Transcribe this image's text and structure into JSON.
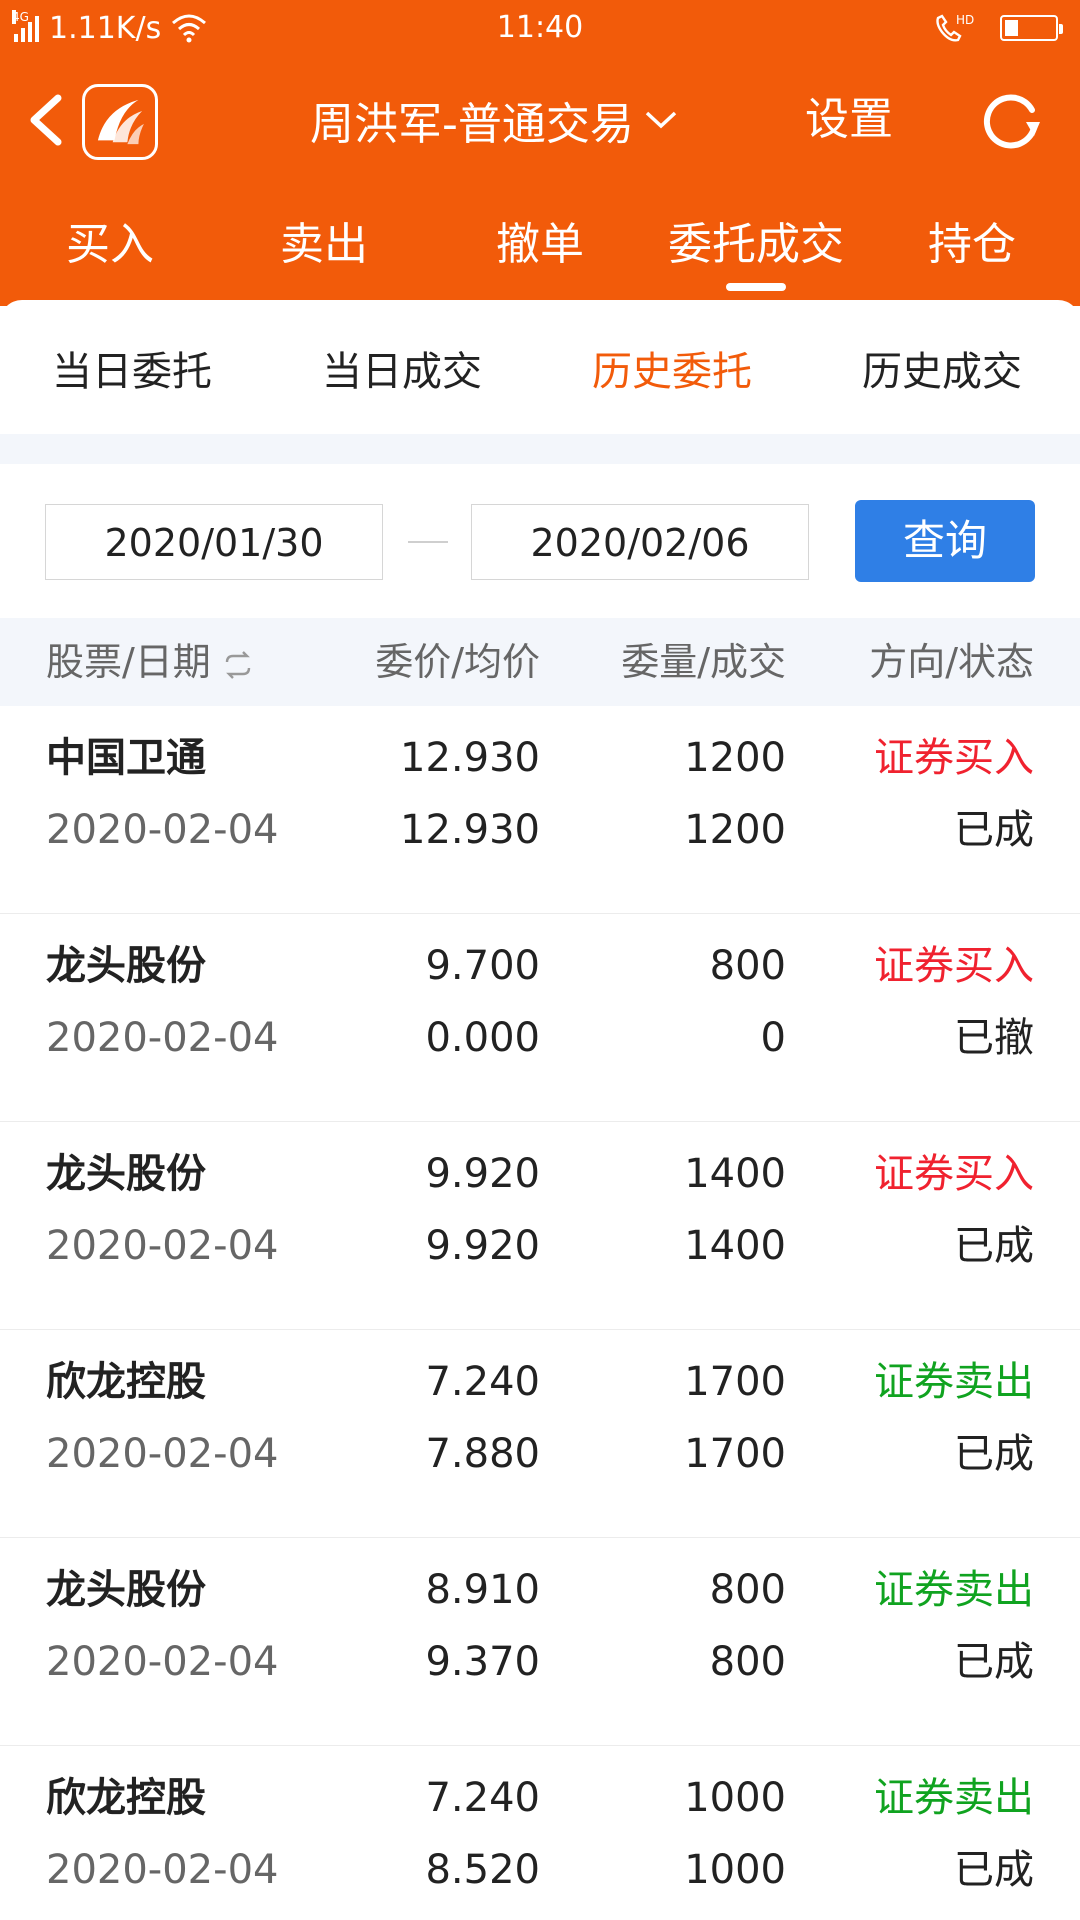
{
  "status_bar": {
    "network": "4G",
    "speed": "1.11K/s",
    "time": "11:40",
    "hd": "HD",
    "battery_level": 0.25
  },
  "header": {
    "title": "周洪军-普通交易",
    "settings_label": "设置",
    "tabs": [
      {
        "label": "买入"
      },
      {
        "label": "卖出"
      },
      {
        "label": "撤单"
      },
      {
        "label": "委托成交"
      },
      {
        "label": "持仓"
      }
    ],
    "active_tab": 3
  },
  "subtabs": [
    {
      "label": "当日委托"
    },
    {
      "label": "当日成交"
    },
    {
      "label": "历史委托"
    },
    {
      "label": "历史成交"
    }
  ],
  "active_subtab": 2,
  "query": {
    "start_date": "2020/01/30",
    "end_date": "2020/02/06",
    "button_label": "查询"
  },
  "table": {
    "columns": [
      "股票/日期",
      "委价/均价",
      "委量/成交",
      "方向/状态"
    ],
    "rows": [
      {
        "name": "中国卫通",
        "date": "2020-02-04",
        "price": "12.930",
        "avg": "12.930",
        "qty": "1200",
        "filled": "1200",
        "direction": "证券买入",
        "status": "已成",
        "side": "buy"
      },
      {
        "name": "龙头股份",
        "date": "2020-02-04",
        "price": "9.700",
        "avg": "0.000",
        "qty": "800",
        "filled": "0",
        "direction": "证券买入",
        "status": "已撤",
        "side": "buy"
      },
      {
        "name": "龙头股份",
        "date": "2020-02-04",
        "price": "9.920",
        "avg": "9.920",
        "qty": "1400",
        "filled": "1400",
        "direction": "证券买入",
        "status": "已成",
        "side": "buy"
      },
      {
        "name": "欣龙控股",
        "date": "2020-02-04",
        "price": "7.240",
        "avg": "7.880",
        "qty": "1700",
        "filled": "1700",
        "direction": "证券卖出",
        "status": "已成",
        "side": "sell"
      },
      {
        "name": "龙头股份",
        "date": "2020-02-04",
        "price": "8.910",
        "avg": "9.370",
        "qty": "800",
        "filled": "800",
        "direction": "证券卖出",
        "status": "已成",
        "side": "sell"
      },
      {
        "name": "欣龙控股",
        "date": "2020-02-04",
        "price": "7.240",
        "avg": "8.520",
        "qty": "1000",
        "filled": "1000",
        "direction": "证券卖出",
        "status": "已成",
        "side": "sell"
      }
    ]
  },
  "colors": {
    "brand_orange": "#f25b0a",
    "buy_red": "#f0222f",
    "sell_green": "#10a320",
    "query_blue": "#2f7fe6"
  },
  "icons": [
    "back-icon",
    "app-logo-icon",
    "chevron-down-icon",
    "refresh-icon",
    "swap-icon",
    "wifi-icon",
    "signal-icon",
    "call-hd-icon",
    "battery-icon"
  ]
}
